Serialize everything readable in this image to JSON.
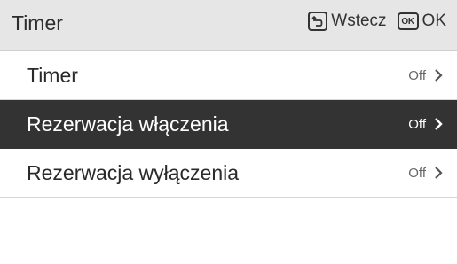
{
  "header": {
    "title": "Timer",
    "back_label": "Wstecz",
    "ok_key": "OK",
    "ok_label": "OK"
  },
  "menu": {
    "items": [
      {
        "label": "Timer",
        "value": "Off",
        "selected": false
      },
      {
        "label": "Rezerwacja włączenia",
        "value": "Off",
        "selected": true
      },
      {
        "label": "Rezerwacja wyłączenia",
        "value": "Off",
        "selected": false
      }
    ]
  },
  "colors": {
    "header_bg": "#e6e6e6",
    "selected_bg": "#333333",
    "text": "#2a2a2a"
  },
  "icons": {
    "back": "back-arrow-icon",
    "ok": "ok-key-icon",
    "chevron": "chevron-right-icon"
  }
}
